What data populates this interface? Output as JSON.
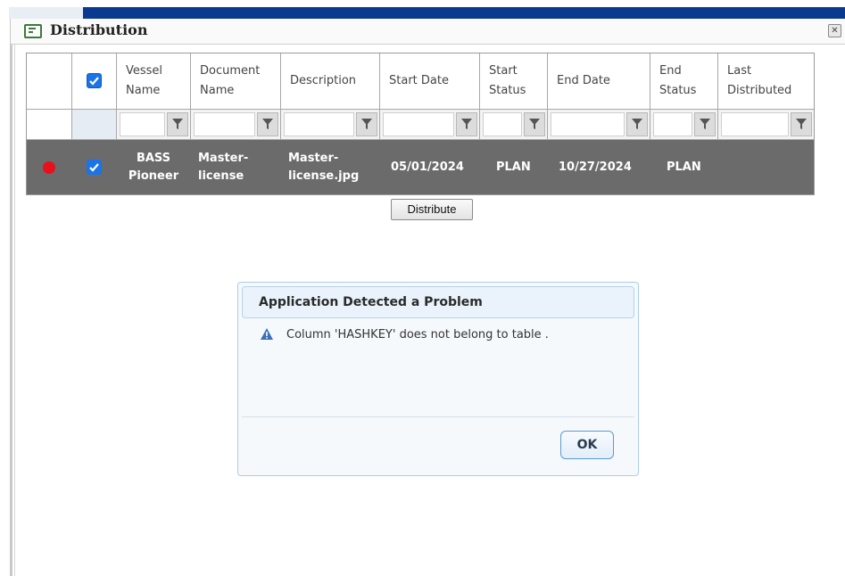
{
  "window": {
    "title": "Distribution",
    "close_icon": "close-icon"
  },
  "grid": {
    "columns": [
      {
        "key": "indicator",
        "label": ""
      },
      {
        "key": "select",
        "label": ""
      },
      {
        "key": "vessel",
        "label": "Vessel\nName"
      },
      {
        "key": "document",
        "label": "Document\nName"
      },
      {
        "key": "description",
        "label": "Description"
      },
      {
        "key": "start_date",
        "label": "Start Date"
      },
      {
        "key": "start_status",
        "label": "Start\nStatus"
      },
      {
        "key": "end_date",
        "label": "End Date"
      },
      {
        "key": "end_status",
        "label": "End\nStatus"
      },
      {
        "key": "last_distributed",
        "label": "Last\nDistributed"
      }
    ],
    "rows": [
      {
        "vessel": "BASS\nPioneer",
        "document": "Master-\nlicense",
        "description": "Master-\nlicense.jpg",
        "start_date": "05/01/2024",
        "start_status": "PLAN",
        "end_date": "10/27/2024",
        "end_status": "PLAN",
        "last_distributed": "",
        "selected": true,
        "status_color": "#e8101a"
      }
    ]
  },
  "distribute_button": "Distribute",
  "dialog": {
    "title": "Application Detected a Problem",
    "message": "Column 'HASHKEY' does not belong to table .",
    "icon": "warning-icon",
    "ok_label": "OK"
  },
  "colors": {
    "header_bar": "#0a3a8f",
    "selected_row": "#6b6b6b",
    "checkbox": "#1a73e8",
    "status_dot": "#e8101a"
  }
}
